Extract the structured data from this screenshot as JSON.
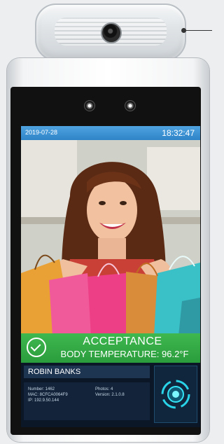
{
  "status_bar": {
    "date": "2019-07-28",
    "time": "18:32:47"
  },
  "result": {
    "status": "ACCEPTANCE",
    "temperature_line": "BODY TEMPERATURE: 96.2°F",
    "color": "#36ad47"
  },
  "person": {
    "name": "ROBIN BANKS",
    "number": "Number: 1462",
    "mac": "MAC: 8CFCA0064F9",
    "ip": "IP: 192.9.50.144",
    "photos": "Photos: 4",
    "version": "Version: 2.1.0.8"
  },
  "icons": {
    "thermal": "thermal-camera-icon",
    "check": "check-circle-icon",
    "scan": "face-scan-icon"
  }
}
